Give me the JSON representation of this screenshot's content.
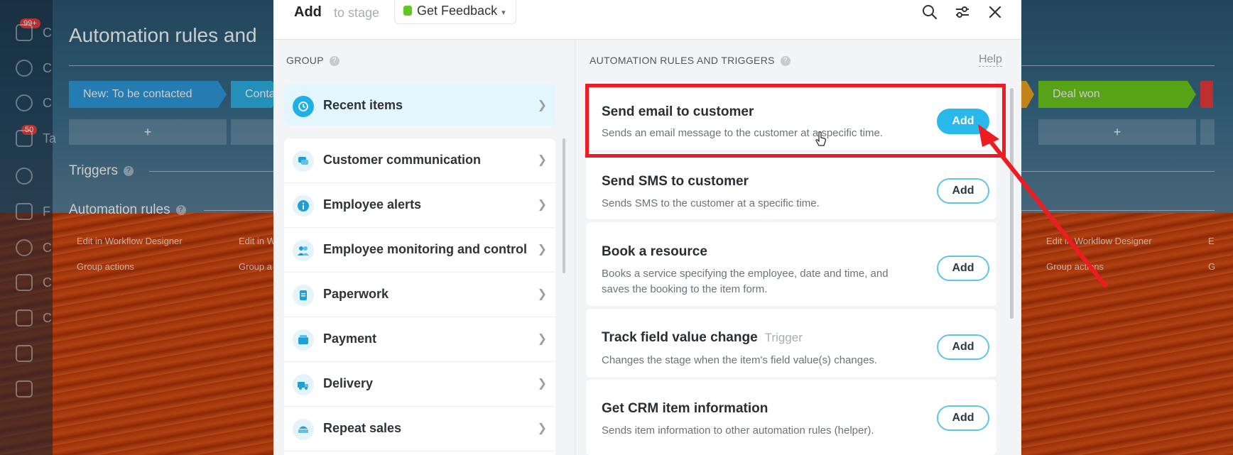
{
  "background": {
    "page_title": "Automation rules and",
    "nav_badges": [
      "99+",
      "50"
    ],
    "nav_labels": [
      "C",
      "C",
      "C",
      "Ta",
      "F",
      "C",
      "C",
      "C"
    ],
    "stages": [
      {
        "label": "New: To be contacted",
        "color": "#2f9be0"
      },
      {
        "label": "Conta",
        "color": "#2db5e8"
      },
      {
        "label": "Deal won",
        "color": "#6fcb1e"
      }
    ],
    "stage_add": "+",
    "triggers_label": "Triggers",
    "automation_label": "Automation rules",
    "links": {
      "edit": "Edit in Workflow Designer",
      "edit_partial": "Edit in W",
      "edit_right": "Edit in Workflow Designer",
      "group": "Group actions",
      "group_partial": "Group a",
      "group_right": "Group actions",
      "edge_e": "E",
      "edge_g": "G"
    }
  },
  "modal": {
    "title": "Add",
    "subtitle": "to stage",
    "stage": "Get Feedback",
    "group_header": "GROUP",
    "rules_header": "AUTOMATION RULES AND TRIGGERS",
    "help_link": "Help",
    "recent_label": "Recent items",
    "groups": [
      {
        "label": "Customer communication",
        "icon": "chat-icon"
      },
      {
        "label": "Employee alerts",
        "icon": "info-icon"
      },
      {
        "label": "Employee monitoring and control",
        "icon": "people-icon"
      },
      {
        "label": "Paperwork",
        "icon": "document-icon"
      },
      {
        "label": "Payment",
        "icon": "wallet-icon"
      },
      {
        "label": "Delivery",
        "icon": "truck-icon"
      },
      {
        "label": "Repeat sales",
        "icon": "repeat-sales-icon"
      }
    ],
    "rules": [
      {
        "title": "Send email to customer",
        "tag": "",
        "desc": "Sends an email message to the customer at a specific time.",
        "button": "Add"
      },
      {
        "title": "Send SMS to customer",
        "tag": "",
        "desc": "Sends SMS to the customer at a specific time.",
        "button": "Add"
      },
      {
        "title": "Book a resource",
        "tag": "",
        "desc": "Books a service specifying the employee, date and time, and saves the booking to the item form.",
        "button": "Add"
      },
      {
        "title": "Track field value change",
        "tag": "Trigger",
        "desc": "Changes the stage when the item's field value(s) changes.",
        "button": "Add"
      },
      {
        "title": "Get CRM item information",
        "tag": "",
        "desc": "Sends item information to other automation rules (helper).",
        "button": "Add"
      }
    ]
  },
  "annotation": {
    "color": "#ee1c22"
  }
}
